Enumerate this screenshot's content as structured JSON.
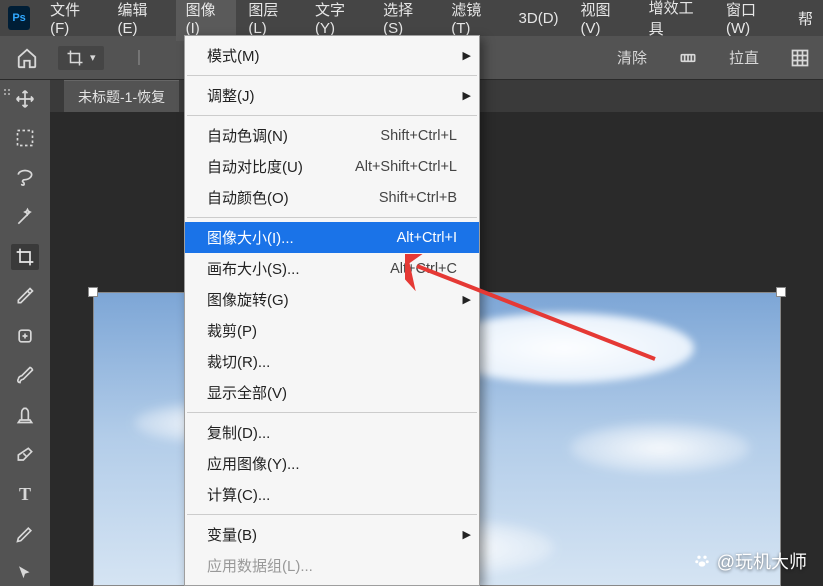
{
  "logo_text": "Ps",
  "menubar": {
    "file": "文件(F)",
    "edit": "编辑(E)",
    "image": "图像(I)",
    "layer": "图层(L)",
    "type": "文字(Y)",
    "select": "选择(S)",
    "filter": "滤镜(T)",
    "threeD": "3D(D)",
    "view": "视图(V)",
    "plugins": "增效工具",
    "window": "窗口(W)",
    "help": "帮"
  },
  "toolbar": {
    "clear": "清除",
    "straighten": "拉直"
  },
  "doc_tab": "未标题-1-恢复",
  "dropdown": {
    "mode": "模式(M)",
    "adjust": "调整(J)",
    "auto_tone": {
      "label": "自动色调(N)",
      "shortcut": "Shift+Ctrl+L"
    },
    "auto_contrast": {
      "label": "自动对比度(U)",
      "shortcut": "Alt+Shift+Ctrl+L"
    },
    "auto_color": {
      "label": "自动颜色(O)",
      "shortcut": "Shift+Ctrl+B"
    },
    "image_size": {
      "label": "图像大小(I)...",
      "shortcut": "Alt+Ctrl+I"
    },
    "canvas_size": {
      "label": "画布大小(S)...",
      "shortcut": "Alt+Ctrl+C"
    },
    "rotate": "图像旋转(G)",
    "crop": "裁剪(P)",
    "trim": "裁切(R)...",
    "reveal_all": "显示全部(V)",
    "duplicate": "复制(D)...",
    "apply_image": "应用图像(Y)...",
    "calculations": "计算(C)...",
    "variables": "变量(B)",
    "apply_dataset": "应用数据组(L)..."
  },
  "watermark": "@玩机大师"
}
